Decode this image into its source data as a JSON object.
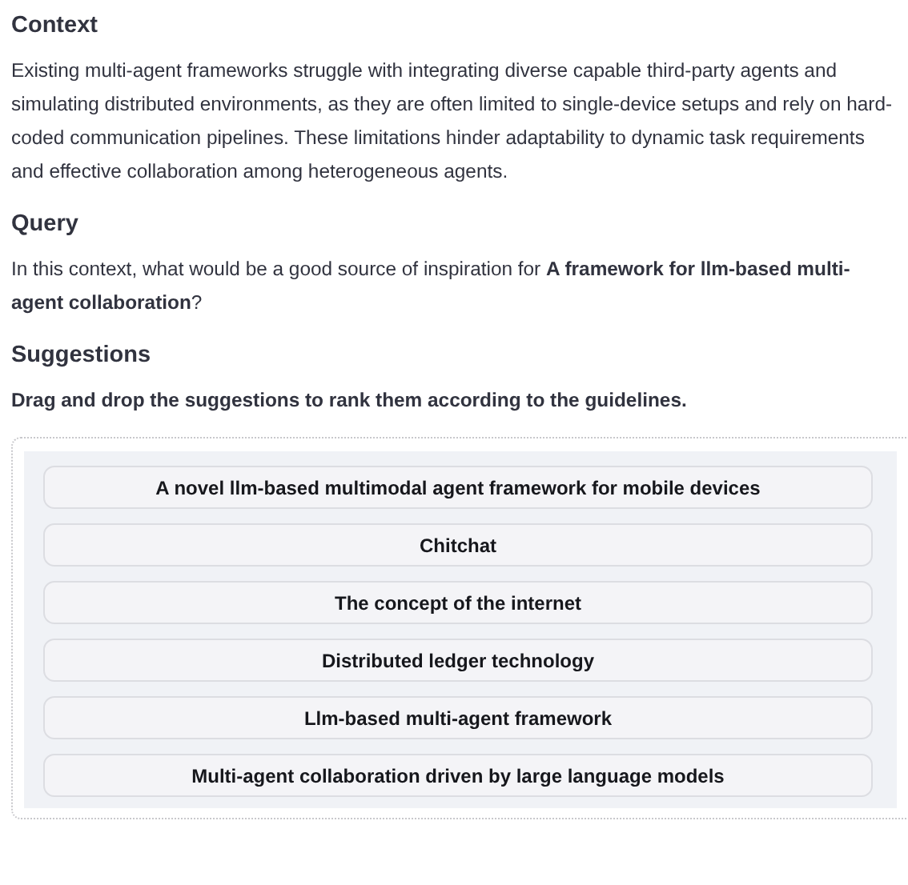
{
  "sections": [
    {
      "kind": "text",
      "heading": "Context",
      "text": "Existing multi-agent frameworks struggle with integrating diverse capable third-party agents and simulating distributed environments, as they are often limited to single-device setups and rely on hard-coded communication pipelines. These limitations hinder adaptability to dynamic task requirements and effective collaboration among heterogeneous agents."
    },
    {
      "kind": "text",
      "heading": "Query",
      "text": "In this context, what would be a good source of inspiration for **A framework for llm-based multi-agent collaboration**?"
    },
    {
      "kind": "ranking",
      "heading": "Suggestions",
      "instruction": "Drag and drop the suggestions to rank them according to the guidelines.",
      "items": [
        "A novel llm-based multimodal agent framework for mobile devices",
        "Chitchat",
        "The concept of the internet",
        "Distributed ledger technology",
        "Llm-based multi-agent framework",
        "Multi-agent collaboration driven by large language models"
      ]
    }
  ]
}
